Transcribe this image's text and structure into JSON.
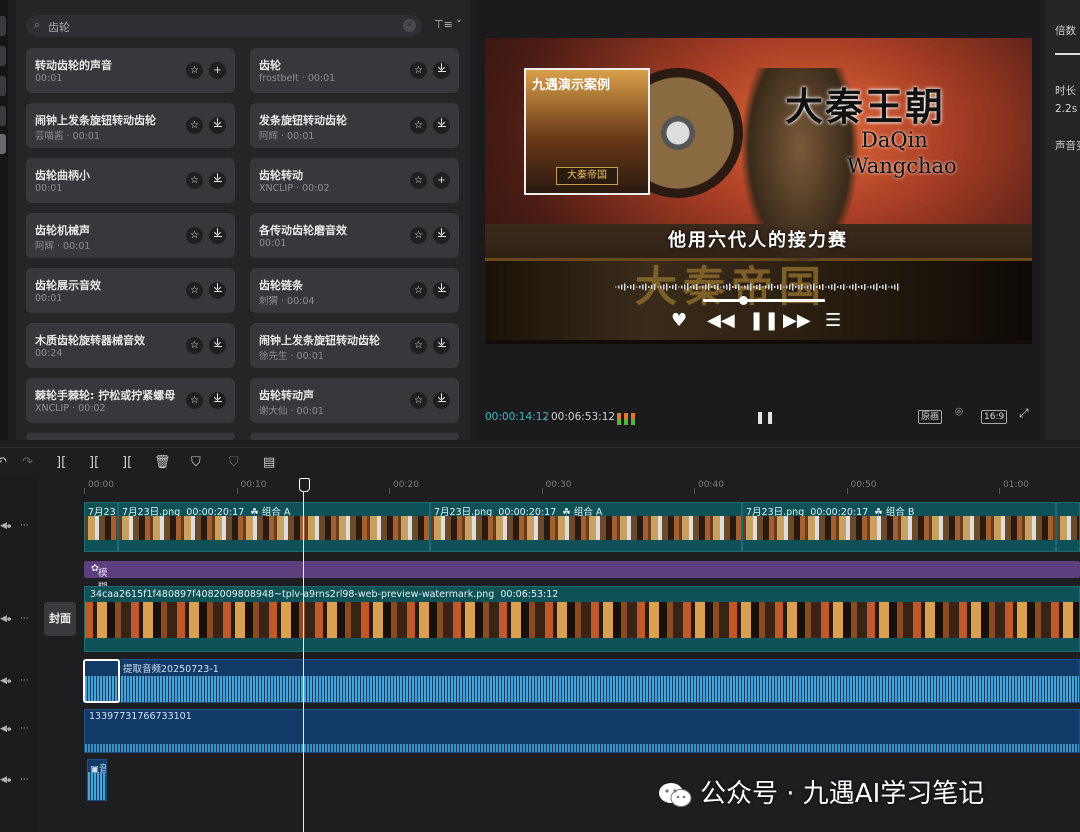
{
  "search": {
    "value": "齿轮",
    "filter_icon": "filter-sort-icon"
  },
  "sounds": [
    {
      "title": "转动齿轮的声音",
      "meta": "00:01",
      "action": "add"
    },
    {
      "title": "齿轮",
      "meta": "frostbelt · 00:01",
      "action": "download"
    },
    {
      "title": "闹钟上发条旋钮转动齿轮",
      "meta": "芸喵酱 · 00:01",
      "action": "download"
    },
    {
      "title": "发条旋钮转动齿轮",
      "meta": "阿辉 · 00:01",
      "action": "download"
    },
    {
      "title": "齿轮曲柄小",
      "meta": "00:01",
      "action": "download"
    },
    {
      "title": "齿轮转动",
      "meta": "XNCLIP · 00:02",
      "action": "add"
    },
    {
      "title": "齿轮机械声",
      "meta": "阿辉 · 00:01",
      "action": "download"
    },
    {
      "title": "各传动齿轮磨音效",
      "meta": "00:01",
      "action": "download"
    },
    {
      "title": "齿轮展示音效",
      "meta": "00:01",
      "action": "download"
    },
    {
      "title": "齿轮链条",
      "meta": "刺猬 · 00:04",
      "action": "download"
    },
    {
      "title": "木质齿轮旋转器械音效",
      "meta": "00:24",
      "action": "download"
    },
    {
      "title": "闹钟上发条旋钮转动齿轮",
      "meta": "徐先生 · 00:01",
      "action": "download"
    },
    {
      "title": "棘轮手棘轮: 拧松或拧紧螺母",
      "meta": "XNCLIP · 00:02",
      "action": "download"
    },
    {
      "title": "齿轮转动声",
      "meta": "谢大仙 · 00:01",
      "action": "download"
    }
  ],
  "video": {
    "thumb_title": "九遇演示案例",
    "thumb_badge": "大秦帝国",
    "title": "大秦王朝",
    "en_line1": "DaQin",
    "en_line2": "Wangchao",
    "subtitle": "他用六代人的接力赛",
    "banner": "大秦帝国",
    "progress": 0.33
  },
  "player": {
    "current": "00:00:14:12",
    "separator": "/",
    "total": "00:06:53:12",
    "btn_original": "原画",
    "btn_ratio": "16:9"
  },
  "props": {
    "speed_label": "倍数",
    "duration_label": "时长",
    "duration_value": "2.2s",
    "voice_label": "声音变"
  },
  "ruler": [
    "00:00",
    "00:10",
    "00:20",
    "00:30",
    "00:40",
    "00:50",
    "01:00"
  ],
  "tracks": {
    "clip_a0": "7月23",
    "clip_a1": "7月23日.png",
    "clip_a1_dur": "00:00:20:17",
    "clip_a1_group": "组合 A",
    "clip_a2": "7月23日.png",
    "clip_a2_dur": "00:00:20:17",
    "clip_a2_group": "组合 A",
    "clip_a3": "7月23日.png",
    "clip_a3_dur": "00:00:20:17",
    "clip_a3_group": "组合 B",
    "blur_effect": "模糊",
    "cover_label": "封面",
    "main_clip": "34caa2615f1f480897f4082009808948~tplv-a9rns2rl98-web-preview-watermark.png",
    "main_clip_dur": "00:06:53:12",
    "audio1": "提取音频20250723-1",
    "audio2": "13397731766733101",
    "audio3": "音"
  },
  "watermark": "公众号 · 九遇AI学习笔记"
}
